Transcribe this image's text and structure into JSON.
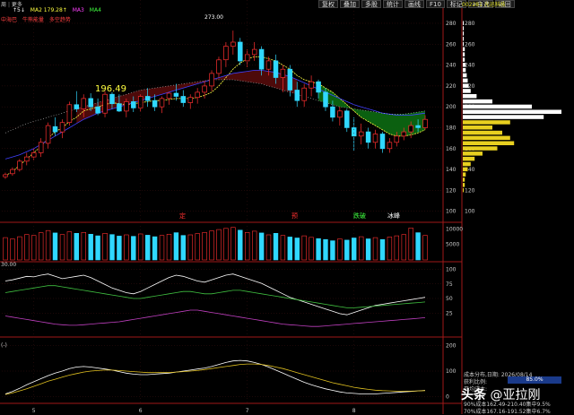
{
  "window": {
    "menu_left": "周",
    "menu_more": "更多",
    "toolbar": [
      "复权",
      "叠加",
      "多股",
      "统计",
      "画线",
      "F10",
      "标记",
      "+自选",
      "返回"
    ],
    "stock_code": "002281 光迅科技"
  },
  "indicators": {
    "prefix": "↑5↓",
    "ma2": "MA2 179.28↑",
    "ma3": "MA3",
    "ma4": "MA4",
    "mid_label": "30.00",
    "small_prefix": "(-)",
    "sub_left": "中海巴",
    "sub_tags": [
      "牛熊能量",
      "多空趋势"
    ]
  },
  "annotations": {
    "low_price": "196.49",
    "high_price": "273.00",
    "signal_labels": [
      "定",
      "预",
      "跌破",
      "冰峰"
    ]
  },
  "chip_panel": {
    "title": "成本分布,日期: 2026/08/14",
    "profit_ratio_label": "获利比例:",
    "profit_ratio": "85.0%",
    "avg_cost_label": "平均成本:",
    "line_90": "90%成本162.49-210.40集中9.5%",
    "line_70": "70%成本167.16-191.52集中6.7%"
  },
  "watermark": {
    "prefix": "头条",
    "handle": "@亚拉刚"
  },
  "chart_data": [
    {
      "type": "candlestick",
      "panel": "main",
      "y_ticks": [
        100,
        120,
        140,
        160,
        180,
        200,
        220,
        240,
        260,
        280
      ],
      "ylim": [
        92,
        292
      ],
      "x_labels": [
        "5",
        "6",
        "7",
        "8"
      ],
      "candles": [
        [
          133,
          137,
          131,
          135
        ],
        [
          136,
          142,
          134,
          140
        ],
        [
          140,
          150,
          138,
          148
        ],
        [
          148,
          156,
          144,
          152
        ],
        [
          152,
          160,
          149,
          156
        ],
        [
          156,
          170,
          152,
          166
        ],
        [
          165,
          185,
          160,
          182
        ],
        [
          181,
          190,
          172,
          176
        ],
        [
          176,
          188,
          170,
          185
        ],
        [
          185,
          205,
          182,
          202
        ],
        [
          202,
          215,
          195,
          198
        ],
        [
          198,
          212,
          190,
          208
        ],
        [
          208,
          213,
          196,
          200
        ],
        [
          200,
          208,
          192,
          194
        ],
        [
          194,
          215,
          190,
          212
        ],
        [
          212,
          214,
          198,
          203
        ],
        [
          203,
          212,
          195,
          196
        ],
        [
          196,
          208,
          190,
          205
        ],
        [
          205,
          210,
          195,
          199
        ],
        [
          199,
          212,
          195,
          210
        ],
        [
          210,
          218,
          200,
          206
        ],
        [
          206,
          212,
          196,
          200
        ],
        [
          200,
          210,
          194,
          208
        ],
        [
          208,
          214,
          202,
          213
        ],
        [
          213,
          222,
          206,
          210
        ],
        [
          210,
          216,
          200,
          204
        ],
        [
          204,
          212,
          198,
          209
        ],
        [
          209,
          218,
          203,
          214
        ],
        [
          214,
          225,
          208,
          220
        ],
        [
          220,
          235,
          215,
          232
        ],
        [
          232,
          248,
          228,
          245
        ],
        [
          245,
          262,
          238,
          258
        ],
        [
          258,
          273,
          250,
          262
        ],
        [
          262,
          266,
          240,
          244
        ],
        [
          244,
          255,
          238,
          250
        ],
        [
          250,
          262,
          244,
          255
        ],
        [
          255,
          258,
          230,
          236
        ],
        [
          236,
          248,
          230,
          244
        ],
        [
          244,
          250,
          222,
          228
        ],
        [
          228,
          240,
          214,
          236
        ],
        [
          236,
          240,
          210,
          216
        ],
        [
          216,
          224,
          200,
          206
        ],
        [
          206,
          222,
          200,
          218
        ],
        [
          218,
          230,
          210,
          224
        ],
        [
          224,
          226,
          208,
          214
        ],
        [
          214,
          218,
          196,
          200
        ],
        [
          200,
          206,
          186,
          190
        ],
        [
          190,
          200,
          182,
          196
        ],
        [
          196,
          198,
          176,
          180
        ],
        [
          180,
          190,
          158,
          172
        ],
        [
          172,
          184,
          164,
          176
        ],
        [
          176,
          180,
          160,
          166
        ],
        [
          166,
          178,
          160,
          174
        ],
        [
          174,
          176,
          156,
          160
        ],
        [
          160,
          170,
          156,
          166
        ],
        [
          166,
          176,
          162,
          172
        ],
        [
          172,
          180,
          168,
          176
        ],
        [
          176,
          186,
          170,
          182
        ],
        [
          182,
          188,
          176,
          180
        ],
        [
          180,
          192,
          178,
          188
        ]
      ],
      "ma_fast": [
        134,
        138,
        144,
        150,
        156,
        162,
        170,
        176,
        180,
        186,
        190,
        196,
        198,
        200,
        202,
        204,
        203,
        202,
        203,
        204,
        205,
        206,
        206,
        207,
        208,
        208,
        208,
        209,
        211,
        214,
        220,
        228,
        236,
        242,
        246,
        248,
        248,
        246,
        244,
        240,
        236,
        230,
        226,
        224,
        222,
        218,
        214,
        208,
        202,
        196,
        190,
        186,
        182,
        178,
        174,
        172,
        172,
        173,
        175,
        178
      ],
      "ma_slow": [
        150,
        152,
        154,
        157,
        160,
        164,
        168,
        172,
        176,
        180,
        184,
        188,
        191,
        194,
        196,
        198,
        200,
        202,
        204,
        206,
        208,
        210,
        212,
        214,
        216,
        218,
        220,
        222,
        224,
        226,
        228,
        230,
        232,
        233,
        234,
        235,
        235,
        234,
        233,
        231,
        229,
        226,
        223,
        220,
        217,
        214,
        211,
        208,
        205,
        202,
        200,
        198,
        196,
        194,
        193,
        192,
        192,
        192,
        193,
        194
      ],
      "ma_long": [
        175,
        178,
        181,
        184,
        186,
        188,
        190,
        192,
        194,
        196,
        198,
        200,
        202,
        204,
        206,
        208,
        210,
        212,
        214,
        216,
        217,
        218,
        219,
        220,
        221,
        222,
        223,
        224,
        225,
        226,
        226,
        226,
        226,
        225,
        224,
        223,
        222,
        220,
        218,
        216,
        214,
        212,
        210,
        208,
        206,
        204,
        202,
        200,
        199,
        198,
        197,
        196,
        195,
        194,
        193,
        193,
        193,
        194,
        195,
        196
      ]
    },
    {
      "type": "bar",
      "panel": "volume",
      "y_ticks": [
        5000,
        10000
      ],
      "ylim": [
        0,
        11000
      ],
      "values": [
        7200,
        6800,
        7500,
        8200,
        7900,
        8800,
        9500,
        8700,
        8200,
        9100,
        8600,
        8900,
        8300,
        7800,
        8600,
        8200,
        7700,
        8100,
        7600,
        8400,
        8000,
        7500,
        7900,
        8300,
        8800,
        7900,
        8100,
        8500,
        8900,
        9400,
        9800,
        10200,
        10500,
        9600,
        8900,
        9300,
        8700,
        8100,
        8600,
        7900,
        7400,
        7100,
        7800,
        7300,
        6900,
        6600,
        6200,
        6800,
        6400,
        7100,
        7500,
        6800,
        7200,
        6600,
        7400,
        7800,
        8200,
        10300,
        8800,
        7900
      ]
    },
    {
      "type": "line",
      "panel": "oscillator",
      "y_ticks": [
        25,
        50,
        75,
        100
      ],
      "ylim": [
        -10,
        110
      ],
      "series": [
        {
          "values": [
            80,
            82,
            85,
            88,
            87,
            90,
            92,
            88,
            84,
            86,
            88,
            90,
            86,
            80,
            74,
            68,
            64,
            60,
            58,
            62,
            68,
            74,
            80,
            86,
            90,
            88,
            84,
            80,
            78,
            82,
            86,
            90,
            92,
            88,
            84,
            80,
            76,
            70,
            64,
            58,
            52,
            48,
            44,
            40,
            36,
            32,
            28,
            24,
            22,
            26,
            30,
            34,
            38,
            40,
            42,
            44,
            46,
            48,
            50,
            52
          ]
        },
        {
          "values": [
            60,
            62,
            64,
            66,
            68,
            70,
            72,
            72,
            70,
            68,
            66,
            64,
            62,
            60,
            58,
            56,
            54,
            52,
            50,
            50,
            52,
            54,
            56,
            58,
            60,
            62,
            62,
            60,
            58,
            58,
            60,
            62,
            64,
            64,
            62,
            60,
            58,
            56,
            54,
            52,
            50,
            48,
            46,
            44,
            42,
            40,
            38,
            36,
            34,
            34,
            35,
            36,
            37,
            38,
            39,
            40,
            41,
            42,
            43,
            44
          ]
        },
        {
          "values": [
            20,
            18,
            16,
            14,
            12,
            10,
            8,
            6,
            5,
            4,
            4,
            5,
            6,
            7,
            8,
            9,
            10,
            12,
            14,
            16,
            18,
            20,
            22,
            24,
            26,
            28,
            30,
            30,
            28,
            26,
            24,
            22,
            20,
            18,
            16,
            14,
            12,
            10,
            8,
            6,
            5,
            4,
            3,
            2,
            2,
            3,
            4,
            5,
            6,
            7,
            8,
            9,
            10,
            11,
            12,
            13,
            14,
            15,
            16,
            17
          ]
        }
      ]
    },
    {
      "type": "line",
      "panel": "macd",
      "y_ticks": [
        0,
        100,
        200
      ],
      "ylim": [
        -20,
        220
      ],
      "series": [
        {
          "values": [
            10,
            20,
            32,
            46,
            58,
            70,
            82,
            92,
            100,
            110,
            116,
            118,
            116,
            112,
            108,
            104,
            98,
            92,
            88,
            86,
            86,
            88,
            90,
            92,
            96,
            100,
            104,
            108,
            112,
            118,
            126,
            134,
            140,
            142,
            140,
            134,
            126,
            116,
            104,
            92,
            80,
            68,
            56,
            46,
            38,
            30,
            24,
            18,
            14,
            12,
            10,
            10,
            10,
            12,
            14,
            16,
            18,
            20,
            22,
            24
          ]
        },
        {
          "values": [
            8,
            14,
            22,
            30,
            40,
            50,
            60,
            68,
            76,
            84,
            90,
            96,
            100,
            102,
            104,
            104,
            102,
            100,
            98,
            96,
            94,
            94,
            94,
            94,
            96,
            98,
            100,
            102,
            106,
            110,
            114,
            118,
            122,
            126,
            128,
            128,
            126,
            122,
            116,
            110,
            102,
            94,
            86,
            78,
            70,
            62,
            54,
            48,
            42,
            36,
            32,
            28,
            25,
            23,
            22,
            21,
            21,
            21,
            22,
            23
          ]
        }
      ]
    },
    {
      "type": "bar",
      "panel": "chip_distribution",
      "ylim": [
        92,
        292
      ],
      "price_levels": [
        120,
        125,
        130,
        135,
        140,
        145,
        150,
        155,
        160,
        165,
        170,
        175,
        180,
        185,
        190,
        195,
        200,
        205,
        210,
        215,
        220,
        225,
        230,
        235,
        240,
        245,
        250,
        255,
        260,
        265,
        270,
        275,
        280
      ],
      "values": [
        1,
        2,
        2,
        3,
        5,
        8,
        12,
        20,
        35,
        52,
        48,
        40,
        30,
        48,
        82,
        100,
        70,
        30,
        14,
        8,
        6,
        5,
        4,
        3,
        3,
        2,
        2,
        2,
        1,
        1,
        1,
        1,
        1
      ]
    }
  ]
}
